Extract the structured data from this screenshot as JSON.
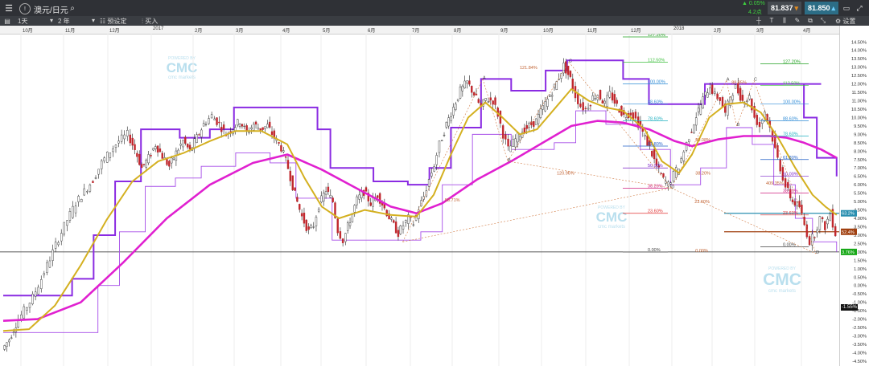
{
  "topbar": {
    "instrument": "澳元/日元",
    "change_pct": "▲ 0.05%",
    "change_pts": "4.2点",
    "bid": "81.837",
    "ask": "81.850"
  },
  "toolbar": {
    "interval": "1天",
    "range": "2 年",
    "preset": "预设定",
    "buy": "买入",
    "settings": "设置"
  },
  "watermark": {
    "brand": "CMC",
    "sub": "cmc markets",
    "top": "POWERED BY"
  },
  "chart_data": {
    "type": "candlestick",
    "date_labels": [
      "10月",
      "11月",
      "12月",
      "2017",
      "2月",
      "3月",
      "4月",
      "5月",
      "6月",
      "7月",
      "8月",
      "9月",
      "10月",
      "11月",
      "12月",
      "2018",
      "2月",
      "3月",
      "4月"
    ],
    "y_ticks": [
      "14.50%",
      "14.00%",
      "13.50%",
      "13.00%",
      "12.50%",
      "12.00%",
      "11.50%",
      "11.00%",
      "10.50%",
      "10.00%",
      "9.50%",
      "9.00%",
      "8.50%",
      "8.00%",
      "7.50%",
      "7.00%",
      "6.50%",
      "6.00%",
      "5.50%",
      "5.00%",
      "4.50%",
      "4.00%",
      "3.50%",
      "3.00%",
      "2.50%",
      "2.00%",
      "1.50%",
      "1.00%",
      "0.50%",
      "0.00%",
      "-0.50%",
      "-1.00%",
      "-1.50%",
      "-2.00%",
      "-2.50%",
      "-3.00%",
      "-3.50%",
      "-4.00%",
      "-4.50%"
    ],
    "ylim": [
      -4.6,
      14.8
    ],
    "price_path": [
      [
        -3.8,
        0
      ],
      [
        -3.2,
        8
      ],
      [
        -2.3,
        16
      ],
      [
        -1.5,
        26
      ],
      [
        -0.7,
        36
      ],
      [
        0.4,
        46
      ],
      [
        1.6,
        56
      ],
      [
        2.8,
        66
      ],
      [
        3.9,
        76
      ],
      [
        4.9,
        86
      ],
      [
        5.6,
        96
      ],
      [
        6.3,
        106
      ],
      [
        7.3,
        116
      ],
      [
        8.0,
        126
      ],
      [
        8.6,
        136
      ],
      [
        9.0,
        146
      ],
      [
        8.1,
        154
      ],
      [
        7.0,
        162
      ],
      [
        7.6,
        170
      ],
      [
        8.4,
        178
      ],
      [
        7.7,
        186
      ],
      [
        7.1,
        194
      ],
      [
        7.9,
        202
      ],
      [
        8.6,
        210
      ],
      [
        8.0,
        218
      ],
      [
        8.8,
        226
      ],
      [
        9.6,
        234
      ],
      [
        10.1,
        244
      ],
      [
        9.6,
        252
      ],
      [
        9.0,
        260
      ],
      [
        9.4,
        268
      ],
      [
        9.8,
        276
      ],
      [
        9.1,
        284
      ],
      [
        9.6,
        292
      ],
      [
        9.3,
        300
      ],
      [
        9.5,
        308
      ],
      [
        8.8,
        316
      ],
      [
        8.2,
        324
      ],
      [
        7.0,
        332
      ],
      [
        5.4,
        340
      ],
      [
        4.1,
        348
      ],
      [
        3.2,
        356
      ],
      [
        3.6,
        362
      ],
      [
        4.8,
        368
      ],
      [
        5.7,
        376
      ],
      [
        5.0,
        384
      ],
      [
        3.3,
        390
      ],
      [
        2.7,
        396
      ],
      [
        3.9,
        404
      ],
      [
        5.1,
        412
      ],
      [
        5.6,
        420
      ],
      [
        4.9,
        428
      ],
      [
        5.4,
        436
      ],
      [
        4.6,
        444
      ],
      [
        3.8,
        452
      ],
      [
        3.1,
        460
      ],
      [
        3.6,
        466
      ],
      [
        4.0,
        472
      ],
      [
        3.7,
        478
      ],
      [
        4.6,
        484
      ],
      [
        5.3,
        490
      ],
      [
        6.3,
        496
      ],
      [
        7.2,
        502
      ],
      [
        8.4,
        508
      ],
      [
        9.6,
        516
      ],
      [
        10.6,
        524
      ],
      [
        11.6,
        532
      ],
      [
        12.1,
        540
      ],
      [
        11.4,
        548
      ],
      [
        10.6,
        556
      ],
      [
        11.1,
        562
      ],
      [
        11.0,
        570
      ],
      [
        10.2,
        576
      ],
      [
        9.0,
        582
      ],
      [
        8.1,
        588
      ],
      [
        8.7,
        596
      ],
      [
        9.2,
        604
      ],
      [
        9.5,
        612
      ],
      [
        9.8,
        620
      ],
      [
        10.6,
        628
      ],
      [
        11.3,
        636
      ],
      [
        12.1,
        644
      ],
      [
        13.1,
        652
      ],
      [
        12.3,
        660
      ],
      [
        11.3,
        666
      ],
      [
        10.7,
        672
      ],
      [
        10.5,
        678
      ],
      [
        11.2,
        686
      ],
      [
        11.4,
        692
      ],
      [
        10.8,
        700
      ],
      [
        11.4,
        706
      ],
      [
        10.7,
        714
      ],
      [
        10.1,
        722
      ],
      [
        10.3,
        730
      ],
      [
        9.9,
        736
      ],
      [
        9.1,
        744
      ],
      [
        8.2,
        752
      ],
      [
        7.1,
        760
      ],
      [
        6.3,
        768
      ],
      [
        6.0,
        774
      ],
      [
        6.6,
        780
      ],
      [
        7.1,
        786
      ],
      [
        8.0,
        792
      ],
      [
        8.9,
        798
      ],
      [
        10.1,
        806
      ],
      [
        11.1,
        814
      ],
      [
        11.9,
        822
      ],
      [
        11.3,
        828
      ],
      [
        11.1,
        834
      ],
      [
        10.2,
        840
      ],
      [
        11.3,
        846
      ],
      [
        11.8,
        852
      ],
      [
        11.0,
        860
      ],
      [
        11.2,
        868
      ],
      [
        10.0,
        874
      ],
      [
        9.5,
        880
      ],
      [
        10.4,
        886
      ],
      [
        9.4,
        892
      ],
      [
        8.1,
        898
      ],
      [
        7.0,
        904
      ],
      [
        5.9,
        910
      ],
      [
        5.0,
        918
      ],
      [
        4.7,
        926
      ],
      [
        3.6,
        932
      ],
      [
        2.6,
        938
      ],
      [
        3.1,
        944
      ],
      [
        4.0,
        950
      ],
      [
        3.5,
        956
      ],
      [
        4.3,
        962
      ],
      [
        3.1,
        968
      ]
    ],
    "moving_average_fast": [
      [
        -2.7,
        0
      ],
      [
        -2.6,
        30
      ],
      [
        -1.2,
        60
      ],
      [
        1.2,
        90
      ],
      [
        3.9,
        120
      ],
      [
        6.2,
        150
      ],
      [
        7.4,
        180
      ],
      [
        7.9,
        210
      ],
      [
        8.6,
        240
      ],
      [
        9.2,
        270
      ],
      [
        9.2,
        300
      ],
      [
        8.4,
        330
      ],
      [
        6.4,
        350
      ],
      [
        4.7,
        370
      ],
      [
        4.0,
        390
      ],
      [
        4.5,
        420
      ],
      [
        4.2,
        450
      ],
      [
        4.1,
        480
      ],
      [
        5.4,
        500
      ],
      [
        7.8,
        520
      ],
      [
        10.0,
        540
      ],
      [
        10.9,
        560
      ],
      [
        10.0,
        580
      ],
      [
        9.0,
        600
      ],
      [
        9.3,
        620
      ],
      [
        10.8,
        645
      ],
      [
        11.7,
        660
      ],
      [
        11.0,
        680
      ],
      [
        10.6,
        700
      ],
      [
        10.4,
        720
      ],
      [
        9.3,
        745
      ],
      [
        7.4,
        765
      ],
      [
        6.7,
        785
      ],
      [
        7.8,
        800
      ],
      [
        10.0,
        820
      ],
      [
        10.8,
        840
      ],
      [
        10.9,
        860
      ],
      [
        10.3,
        880
      ],
      [
        8.8,
        900
      ],
      [
        7.0,
        920
      ],
      [
        5.4,
        940
      ],
      [
        4.7,
        955
      ],
      [
        4.2,
        968
      ]
    ],
    "moving_average_slow": [
      [
        -2.1,
        0
      ],
      [
        -2.0,
        40
      ],
      [
        -1.0,
        90
      ],
      [
        1.4,
        140
      ],
      [
        4.0,
        190
      ],
      [
        6.0,
        240
      ],
      [
        7.3,
        290
      ],
      [
        7.8,
        330
      ],
      [
        6.9,
        370
      ],
      [
        5.8,
        410
      ],
      [
        4.7,
        450
      ],
      [
        4.3,
        480
      ],
      [
        4.9,
        510
      ],
      [
        6.3,
        550
      ],
      [
        7.4,
        590
      ],
      [
        8.6,
        630
      ],
      [
        9.5,
        660
      ],
      [
        9.8,
        690
      ],
      [
        9.7,
        720
      ],
      [
        9.3,
        750
      ],
      [
        8.6,
        780
      ],
      [
        8.3,
        800
      ],
      [
        8.7,
        830
      ],
      [
        8.9,
        860
      ],
      [
        8.9,
        890
      ],
      [
        8.8,
        910
      ],
      [
        8.5,
        930
      ],
      [
        8.1,
        950
      ],
      [
        7.6,
        968
      ]
    ],
    "upper_channel": [
      [
        -0.6,
        0
      ],
      [
        -0.6,
        60
      ],
      [
        0.4,
        80
      ],
      [
        3.0,
        105
      ],
      [
        6.2,
        130
      ],
      [
        9.3,
        160
      ],
      [
        8.8,
        205
      ],
      [
        9.3,
        240
      ],
      [
        10.6,
        268
      ],
      [
        10.6,
        330
      ],
      [
        9.3,
        365
      ],
      [
        7.0,
        380
      ],
      [
        6.2,
        430
      ],
      [
        6.0,
        470
      ],
      [
        7.0,
        495
      ],
      [
        9.4,
        520
      ],
      [
        12.3,
        555
      ],
      [
        11.6,
        590
      ],
      [
        12.8,
        630
      ],
      [
        13.4,
        655
      ],
      [
        13.4,
        700
      ],
      [
        12.3,
        720
      ],
      [
        10.8,
        750
      ],
      [
        10.8,
        790
      ],
      [
        12.0,
        815
      ],
      [
        12.0,
        950
      ],
      [
        10.0,
        930
      ],
      [
        7.6,
        945
      ],
      [
        6.5,
        968
      ]
    ],
    "lower_channel": [
      [
        -2.8,
        0
      ],
      [
        -2.8,
        90
      ],
      [
        0.0,
        110
      ],
      [
        3.2,
        135
      ],
      [
        5.9,
        165
      ],
      [
        6.4,
        200
      ],
      [
        7.1,
        230
      ],
      [
        7.9,
        270
      ],
      [
        7.3,
        310
      ],
      [
        5.2,
        340
      ],
      [
        2.7,
        382
      ],
      [
        2.7,
        460
      ],
      [
        3.2,
        485
      ],
      [
        6.0,
        510
      ],
      [
        9.0,
        545
      ],
      [
        8.1,
        590
      ],
      [
        8.5,
        640
      ],
      [
        10.4,
        665
      ],
      [
        9.6,
        700
      ],
      [
        8.1,
        740
      ],
      [
        6.0,
        775
      ],
      [
        7.0,
        810
      ],
      [
        9.4,
        840
      ],
      [
        8.4,
        870
      ],
      [
        6.0,
        895
      ],
      [
        4.0,
        920
      ],
      [
        2.6,
        940
      ],
      [
        2.0,
        968
      ]
    ],
    "fibonacci_levels": [
      {
        "label": "127.20%",
        "value": 14.8,
        "color": "#20a020"
      },
      {
        "label": "112.50%",
        "value": 13.3,
        "color": "#40c040"
      },
      {
        "label": "100.00%",
        "value": 12.0,
        "color": "#2e8bd6"
      },
      {
        "label": "88.60%",
        "value": 10.8,
        "color": "#2e8bd6"
      },
      {
        "label": "78.60%",
        "value": 9.8,
        "color": "#20b0c0"
      },
      {
        "label": "61.80%",
        "value": 8.3,
        "color": "#2060c8"
      },
      {
        "label": "50.00%",
        "value": 7.0,
        "color": "#7a20c8"
      },
      {
        "label": "38.20%",
        "value": 5.8,
        "color": "#d02080"
      },
      {
        "label": "23.60%",
        "value": 4.3,
        "color": "#e03030"
      },
      {
        "label": "0.00%",
        "value": 2.0,
        "color": "#444444"
      }
    ],
    "fibonacci_levels_right": [
      {
        "label": "127.20%",
        "value": 13.2,
        "color": "#20a020"
      },
      {
        "label": "112.50%",
        "value": 11.9,
        "color": "#40c040"
      },
      {
        "label": "100.00%",
        "value": 10.8,
        "color": "#2e8bd6"
      },
      {
        "label": "88.60%",
        "value": 9.8,
        "color": "#2e8bd6"
      },
      {
        "label": "78.60%",
        "value": 8.9,
        "color": "#20b0c0"
      },
      {
        "label": "61.80%",
        "value": 7.5,
        "color": "#2060c8"
      },
      {
        "label": "50.00%",
        "value": 6.5,
        "color": "#7a20c8"
      },
      {
        "label": "38.20%",
        "value": 5.5,
        "color": "#d02080"
      },
      {
        "label": "23.60%",
        "value": 4.2,
        "color": "#e03030"
      },
      {
        "label": "0.00%",
        "value": 2.3,
        "color": "#444444"
      }
    ],
    "pattern_labels": [
      {
        "text": "A",
        "x": 557,
        "y": 12.3
      },
      {
        "text": "B",
        "x": 586,
        "y": 7.4
      },
      {
        "text": "C",
        "x": 657,
        "y": 13.3
      },
      {
        "text": "D",
        "x": 776,
        "y": 5.8
      },
      {
        "text": "A",
        "x": 840,
        "y": 12.2
      },
      {
        "text": "C",
        "x": 872,
        "y": 12.2
      },
      {
        "text": "B",
        "x": 852,
        "y": 9.5
      },
      {
        "text": "D",
        "x": 944,
        "y": 1.9
      },
      {
        "text": "121.84%",
        "x": 600,
        "y": 12.9
      },
      {
        "text": "120.96%",
        "x": 643,
        "y": 6.6
      },
      {
        "text": "58.71%",
        "x": 513,
        "y": 5.0
      },
      {
        "text": "88.85%",
        "x": 846,
        "y": 12.0
      },
      {
        "text": "409.35%",
        "x": 886,
        "y": 6.0
      },
      {
        "text": "90.08%",
        "x": 804,
        "y": 8.6
      },
      {
        "text": "38.20%",
        "x": 804,
        "y": 6.6
      },
      {
        "text": "23.60%",
        "x": 803,
        "y": 4.9
      },
      {
        "text": "0.00%",
        "x": 804,
        "y": 2.0
      },
      {
        "text": "0.00%",
        "x": 974,
        "y": 6.0
      },
      {
        "text": "23.60%",
        "x": 974,
        "y": 7.3
      }
    ],
    "horizontal_lines": [
      {
        "value": 4.3,
        "color": "#2a8fb0",
        "label": "63.2%"
      },
      {
        "value": 3.2,
        "color": "#a04010",
        "label": "52.4%"
      },
      {
        "value": 2.0,
        "color": "#222222",
        "label": "3.76%"
      }
    ],
    "last_tag": "-1.55%"
  }
}
